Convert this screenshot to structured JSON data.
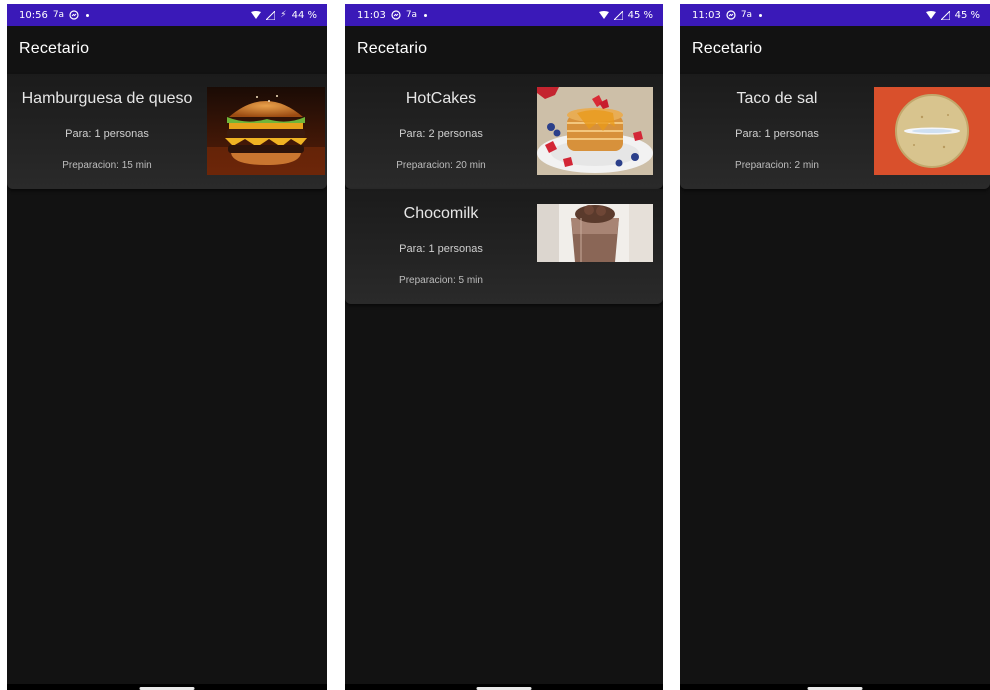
{
  "screens": [
    {
      "status": {
        "time": "10:56",
        "left_icons": [
          "7a-icon",
          "messenger-icon"
        ],
        "battery": "44 %"
      },
      "app_title": "Recetario",
      "recipes": [
        {
          "name": "Hamburguesa de queso",
          "servings": "Para: 1 personas",
          "time": "Preparacion: 15 min",
          "image": "hamburger-image"
        }
      ]
    },
    {
      "status": {
        "time": "11:03",
        "left_icons": [
          "messenger-icon",
          "7a-icon"
        ],
        "battery": "45 %"
      },
      "app_title": "Recetario",
      "recipes": [
        {
          "name": "HotCakes",
          "servings": "Para: 2 personas",
          "time": "Preparacion: 20 min",
          "image": "pancakes-image"
        },
        {
          "name": "Chocomilk",
          "servings": "Para: 1 personas",
          "time": "Preparacion: 5 min",
          "image": "chocomilk-image"
        }
      ]
    },
    {
      "status": {
        "time": "11:03",
        "left_icons": [
          "messenger-icon",
          "7a-icon"
        ],
        "battery": "45 %"
      },
      "app_title": "Recetario",
      "recipes": [
        {
          "name": "Taco de sal",
          "servings": "Para: 1 personas",
          "time": "Preparacion: 2 min",
          "image": "tortilla-image"
        }
      ]
    }
  ],
  "colors": {
    "status_bar": "#3a19b8",
    "background": "#121212",
    "card": "#232323"
  }
}
